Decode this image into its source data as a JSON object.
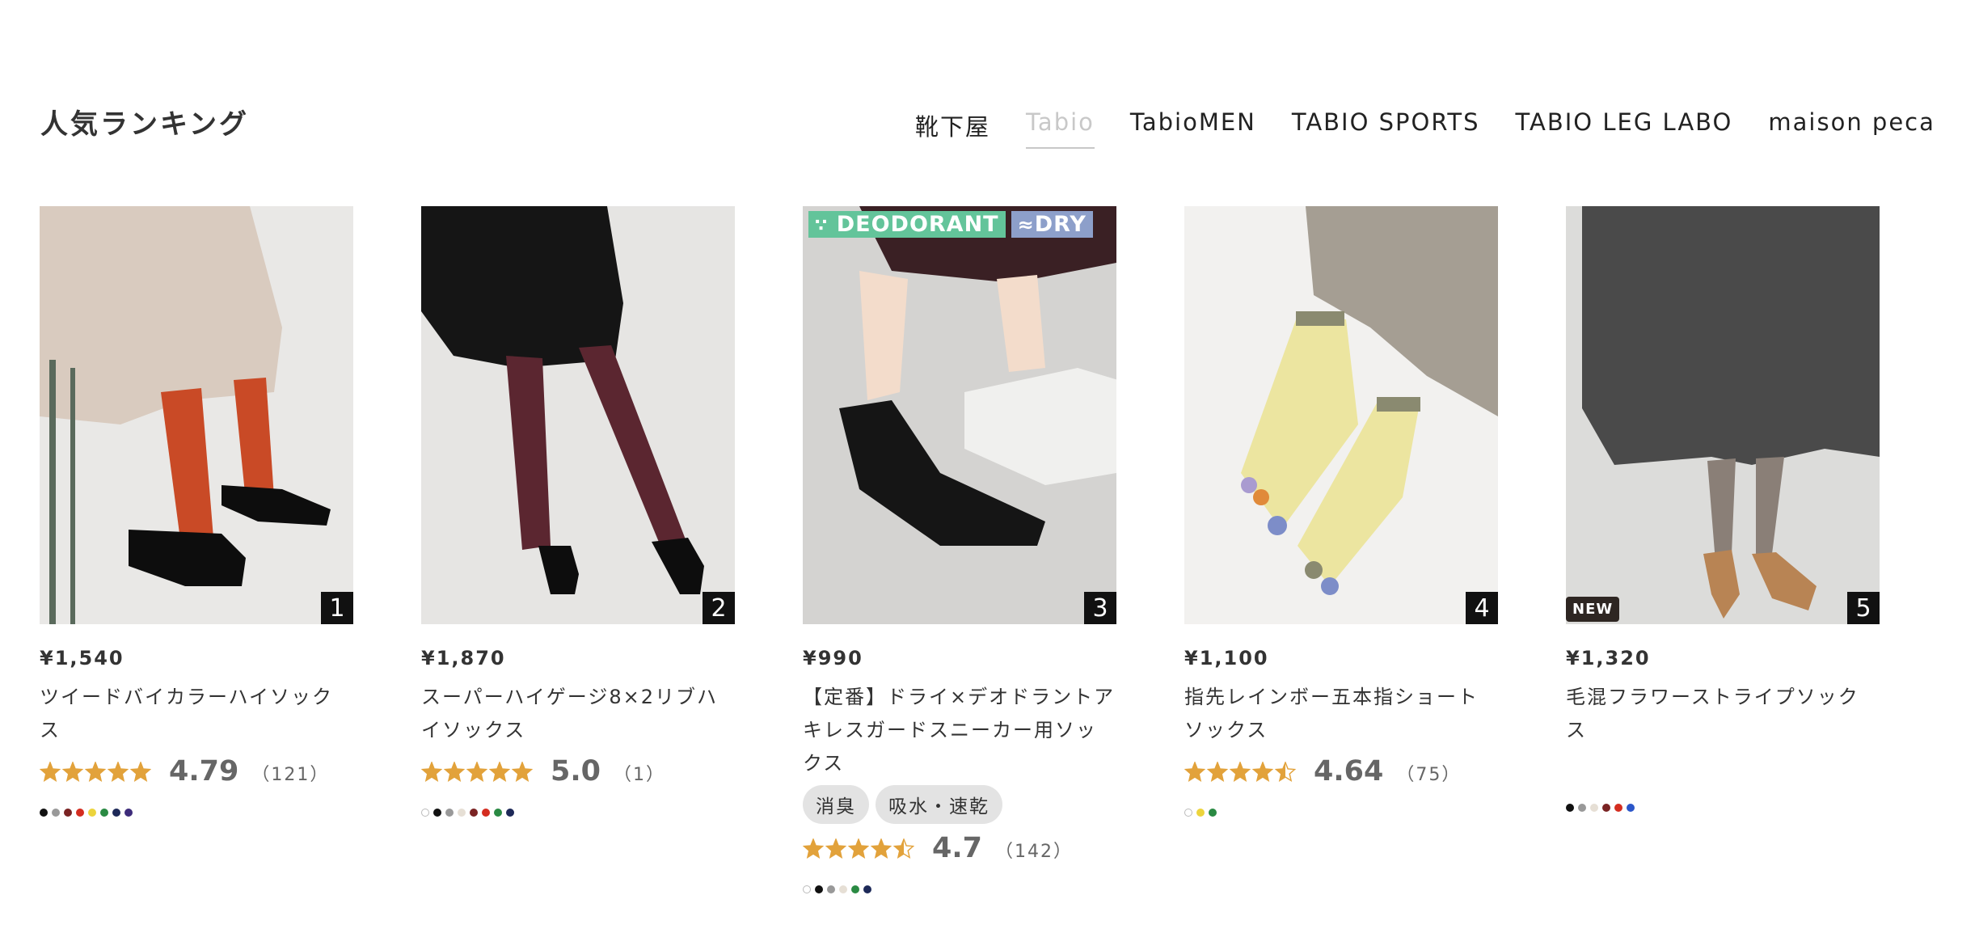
{
  "ranking": {
    "title": "人気ランキング",
    "tabs": [
      {
        "label": "靴下屋",
        "active": false
      },
      {
        "label": "Tabio",
        "active": true
      },
      {
        "label": "TabioMEN",
        "active": false
      },
      {
        "label": "TABIO SPORTS",
        "active": false
      },
      {
        "label": "TABIO LEG LABO",
        "active": false
      },
      {
        "label": "maison peca",
        "active": false
      }
    ]
  },
  "products": [
    {
      "rank": "1",
      "price": "¥1,540",
      "name": "ツイードバイカラーハイソックス",
      "rating": {
        "score": "4.79",
        "count": "（121）",
        "stars": 5
      },
      "colors": [
        "#111111",
        "#999999",
        "#7a2323",
        "#d42d20",
        "#ecd43c",
        "#2a8a43",
        "#1d2958",
        "#3d2b7a"
      ],
      "image": {
        "bg": "#e9e8e6",
        "skirt": "#d9cbbf",
        "sock": "#c94a26",
        "shoe": "#0d0d0d"
      }
    },
    {
      "rank": "2",
      "price": "¥1,870",
      "name": "スーパーハイゲージ8×2リブハイソックス",
      "rating": {
        "score": "5.0",
        "count": "（1）",
        "stars": 5
      },
      "colors": [
        "#ffffff",
        "#111111",
        "#999999",
        "#e6dfd5",
        "#7a2323",
        "#d42d20",
        "#2a8a43",
        "#1d2958"
      ],
      "image": {
        "bg": "#e6e5e3",
        "skirt": "#151515",
        "sock": "#5b2630",
        "shoe": "#0d0d0d"
      }
    },
    {
      "rank": "3",
      "price": "¥990",
      "name": "【定番】ドライ×デオドラントアキレスガードスニーカー用ソックス",
      "tags": [
        "消臭",
        "吸水・速乾"
      ],
      "features": [
        {
          "label": "DEODORANT",
          "icon": "deodorant-icon",
          "color": "#63c49a"
        },
        {
          "label": "DRY",
          "icon": "wave-icon",
          "color": "#8d9fca"
        }
      ],
      "rating": {
        "score": "4.7",
        "count": "（142）",
        "stars": 4.5
      },
      "colors": [
        "#ffffff",
        "#111111",
        "#999999",
        "#e6dfd5",
        "#2a8a43",
        "#1d2958"
      ],
      "image": {
        "bg": "#d4d3d1",
        "skirt": "#3a2024",
        "sock": "#151515",
        "shoe": "#f0f0ee"
      }
    },
    {
      "rank": "4",
      "price": "¥1,100",
      "name": "指先レインボー五本指ショートソックス",
      "rating": {
        "score": "4.64",
        "count": "（75）",
        "stars": 4.5
      },
      "colors": [
        "#ffffff",
        "#ecd43c",
        "#2a8a43"
      ],
      "image": {
        "bg": "#f2f1ef",
        "skirt": "#a59e93",
        "sock": "#ece5a0",
        "shoe": "#8c8c7c"
      }
    },
    {
      "rank": "5",
      "price": "¥1,320",
      "name": "毛混フラワーストライプソックス",
      "new_badge": "NEW",
      "colors": [
        "#111111",
        "#999999",
        "#e6dfd5",
        "#7a2323",
        "#d42d20",
        "#2b56c9"
      ],
      "image": {
        "bg": "#dcdcda",
        "skirt": "#4a4a4a",
        "sock": "#8a7f77",
        "shoe": "#b88454"
      }
    }
  ]
}
